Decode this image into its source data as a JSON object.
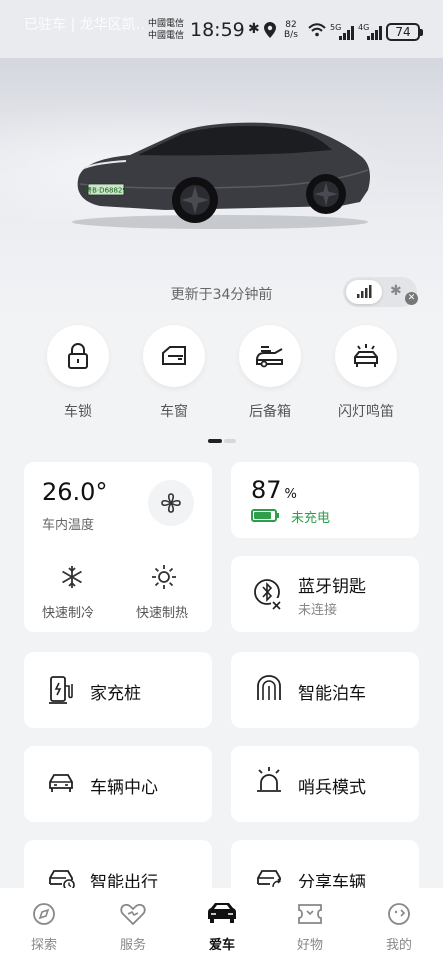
{
  "status_bar": {
    "location_text": "已驻车 | 龙华区凯…",
    "carrier_1": "中國電信",
    "carrier_2": "中國電信",
    "time": "18:59",
    "net_speed_value": "82",
    "net_speed_unit": "B/s",
    "net_1": "5G",
    "net_2": "4G",
    "battery_level": "74"
  },
  "vehicle": {
    "plate": "粤B·D68829",
    "updated_text": "更新于34分钟前",
    "connection_mode": "cellular"
  },
  "quick_actions": [
    {
      "label": "车锁",
      "icon": "lock-icon"
    },
    {
      "label": "车窗",
      "icon": "window-icon"
    },
    {
      "label": "后备箱",
      "icon": "trunk-icon"
    },
    {
      "label": "闪灯鸣笛",
      "icon": "flash-horn-icon"
    }
  ],
  "climate": {
    "temperature": "26.0",
    "unit": "°",
    "label": "车内温度",
    "cool_label": "快速制冷",
    "heat_label": "快速制热"
  },
  "battery": {
    "percent": "87",
    "unit": "%",
    "fill_fraction": 0.87,
    "status": "未充电",
    "color": "#2e9e4a"
  },
  "bluetooth_key": {
    "title": "蓝牙钥匙",
    "status": "未连接"
  },
  "features": [
    {
      "label": "家充桩",
      "icon": "home-charger-icon"
    },
    {
      "label": "智能泊车",
      "icon": "smart-parking-icon"
    },
    {
      "label": "车辆中心",
      "icon": "vehicle-center-icon"
    },
    {
      "label": "哨兵模式",
      "icon": "sentry-mode-icon"
    },
    {
      "label": "智能出行",
      "icon": "smart-travel-icon"
    },
    {
      "label": "分享车辆",
      "icon": "share-vehicle-icon"
    }
  ],
  "tabs": [
    {
      "label": "探索",
      "icon": "explore-icon",
      "active": false
    },
    {
      "label": "服务",
      "icon": "service-icon",
      "active": false
    },
    {
      "label": "爱车",
      "icon": "car-icon",
      "active": true
    },
    {
      "label": "好物",
      "icon": "shop-icon",
      "active": false
    },
    {
      "label": "我的",
      "icon": "profile-icon",
      "active": false
    }
  ]
}
